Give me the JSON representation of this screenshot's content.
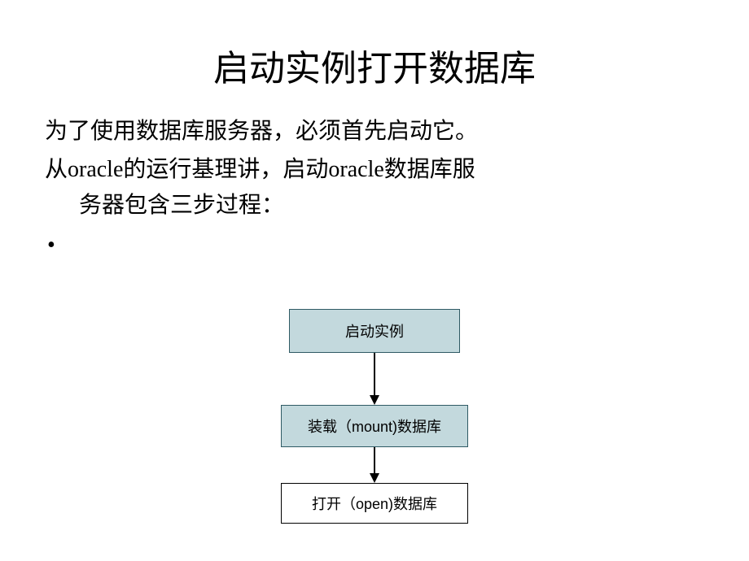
{
  "title": "启动实例打开数据库",
  "para1": "为了使用数据库服务器，必须首先启动它。",
  "para2_line1": "从oracle的运行基理讲，启动oracle数据库服",
  "para2_line2": "务器包含三步过程：",
  "bullet": "•",
  "flow": {
    "step1": "启动实例",
    "step2": "装载（mount)数据库",
    "step3": "打开（open)数据库"
  }
}
